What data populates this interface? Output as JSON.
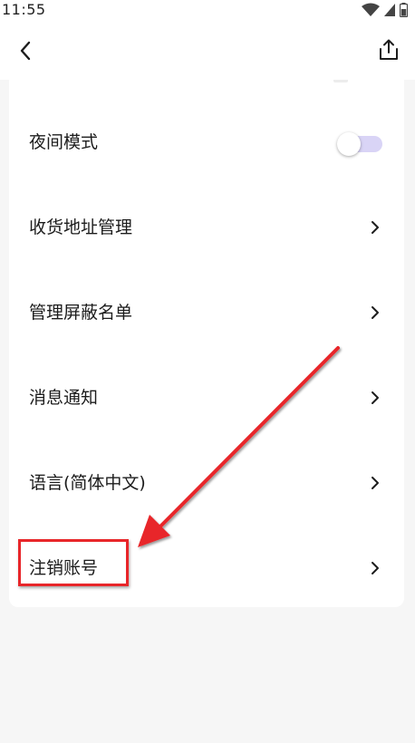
{
  "status_bar": {
    "time": "11:55",
    "icons": [
      "wifi-icon",
      "signal-icon",
      "battery-icon"
    ]
  },
  "header": {
    "back_icon": "chevron-left-icon",
    "share_icon": "share-icon"
  },
  "settings": {
    "items": [
      {
        "label": "夜间模式",
        "control": "toggle",
        "toggle_on": false
      },
      {
        "label": "收货地址管理",
        "control": "chevron"
      },
      {
        "label": "管理屏蔽名单",
        "control": "chevron"
      },
      {
        "label": "消息通知",
        "control": "chevron"
      },
      {
        "label": "语言(简体中文)",
        "control": "chevron"
      },
      {
        "label": "注销账号",
        "control": "chevron"
      }
    ]
  },
  "colors": {
    "background": "#f6f6f6",
    "card": "#ffffff",
    "toggle_track": "#d9d4f6",
    "annotation": "#e8262a"
  }
}
